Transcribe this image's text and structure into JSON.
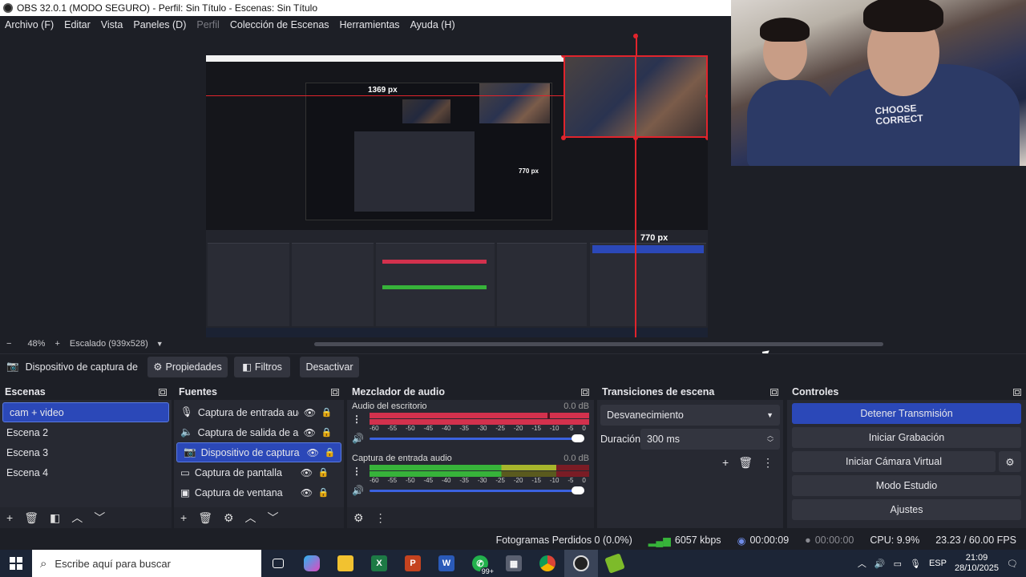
{
  "window": {
    "title": "OBS 32.0.1 (MODO SEGURO) - Perfil: Sin Título - Escenas: Sin Título"
  },
  "menu": [
    "Archivo (F)",
    "Editar",
    "Vista",
    "Paneles (D)",
    "Perfil",
    "Colección de Escenas",
    "Herramientas",
    "Ayuda (H)"
  ],
  "preview": {
    "guide_label_top": "1369 px",
    "guide_label_right": "770 px",
    "guide_label_inner": "770 px",
    "zoom": "48%",
    "scaled": "Escalado (939x528)",
    "webcam_shirt_text": "CHOOSE CORRECT"
  },
  "source_bar": {
    "source_name": "Dispositivo de captura de v",
    "properties": "Propiedades",
    "filters": "Filtros",
    "deactivate": "Desactivar"
  },
  "scenes": {
    "title": "Escenas",
    "items": [
      "cam + video",
      "Escena 2",
      "Escena 3",
      "Escena 4"
    ],
    "selected_index": 0
  },
  "sources": {
    "title": "Fuentes",
    "items": [
      {
        "label": "Captura de entrada audi",
        "icon": "microphone-icon"
      },
      {
        "label": "Captura de salida de aud",
        "icon": "speaker-icon"
      },
      {
        "label": "Dispositivo de captura de",
        "icon": "camera-icon"
      },
      {
        "label": "Captura de pantalla",
        "icon": "monitor-icon"
      },
      {
        "label": "Captura de ventana",
        "icon": "window-icon"
      }
    ],
    "selected_index": 2
  },
  "mixer": {
    "title": "Mezclador de audio",
    "scale": [
      "-60",
      "-55",
      "-50",
      "-45",
      "-40",
      "-35",
      "-30",
      "-25",
      "-20",
      "-15",
      "-10",
      "-5",
      "0"
    ],
    "channels": [
      {
        "name": "Audio del escritorio",
        "db": "0.0 dB",
        "meter_color": "#d3314d",
        "volume": 1.0
      },
      {
        "name": "Captura de entrada audio",
        "db": "0.0 dB",
        "meter_color": "#37b33a",
        "volume": 1.0
      }
    ]
  },
  "transitions": {
    "title": "Transiciones de escena",
    "selected": "Desvanecimiento",
    "duration_label": "Duración",
    "duration_value": "300 ms"
  },
  "controls": {
    "title": "Controles",
    "buttons": [
      "Detener Transmisión",
      "Iniciar Grabación",
      "Iniciar Cámara Virtual",
      "Modo Estudio",
      "Ajustes"
    ]
  },
  "status": {
    "dropped": "Fotogramas Perdidos 0 (0.0%)",
    "bitrate": "6057 kbps",
    "stream_time": "00:00:09",
    "rec_time": "00:00:00",
    "cpu": "CPU: 9.9%",
    "fps": "23.23 / 60.00 FPS"
  },
  "taskbar": {
    "search_placeholder": "Escribe aquí para buscar",
    "whatsapp_badge": "99+",
    "lang": "ESP",
    "time": "21:09",
    "date": "28/10/2025"
  },
  "colors": {
    "accent": "#2b48b8",
    "guide_red": "#e0242c",
    "bg": "#1d1f26",
    "dock": "#272932"
  }
}
